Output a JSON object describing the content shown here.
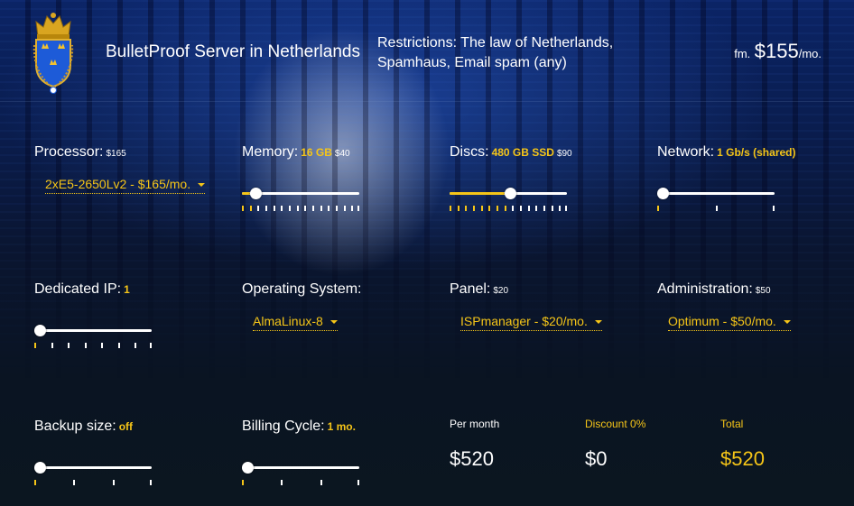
{
  "header": {
    "title": "BulletProof Server in Netherlands",
    "restrictions": "Restrictions: The law of Netherlands, Spamhaus, Email spam (any)",
    "price_prefix": "fm.",
    "price_amount": "$155",
    "price_suffix": "/mo.",
    "logo_icon": "royal-crest-icon"
  },
  "options": {
    "processor": {
      "label": "Processor:",
      "extra": "$165",
      "selected": "2xE5-2650Lv2 - $165/mo."
    },
    "memory": {
      "label": "Memory:",
      "value": "16 GB",
      "extra": "$40",
      "ticks": 16,
      "position": 1
    },
    "discs": {
      "label": "Discs:",
      "value": "480 GB SSD",
      "extra": "$90",
      "ticks": 16,
      "position": 7
    },
    "network": {
      "label": "Network:",
      "value": "1 Gb/s (shared)",
      "ticks": 3,
      "position": 0
    },
    "dedicated_ip": {
      "label": "Dedicated IP:",
      "value": "1",
      "ticks": 8,
      "position": 0
    },
    "operating_system": {
      "label": "Operating System:",
      "selected": "AlmaLinux-8"
    },
    "panel": {
      "label": "Panel:",
      "extra": "$20",
      "selected": "ISPmanager - $20/mo."
    },
    "administration": {
      "label": "Administration:",
      "extra": "$50",
      "selected": "Optimum - $50/mo."
    },
    "backup_size": {
      "label": "Backup size:",
      "value": "off",
      "ticks": 4,
      "position": 0
    },
    "billing_cycle": {
      "label": "Billing Cycle:",
      "value": "1 mo.",
      "ticks": 4,
      "position": 0
    }
  },
  "summary": {
    "per_month_label": "Per month",
    "per_month_value": "$520",
    "discount_label": "Discount 0%",
    "discount_value": "$0",
    "total_label": "Total",
    "total_value": "$520"
  },
  "colors": {
    "accent": "#f5c518",
    "text": "#ffffff",
    "background": "#0a1422"
  }
}
